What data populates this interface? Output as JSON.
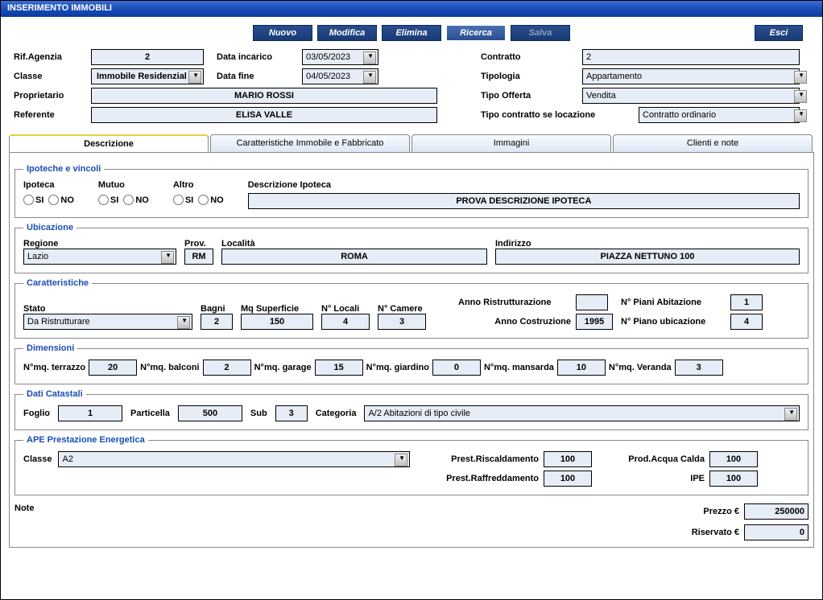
{
  "window": {
    "title": "INSERIMENTO IMMOBILI"
  },
  "toolbar": {
    "nuovo": "Nuovo",
    "modifica": "Modifica",
    "elimina": "Elimina",
    "ricerca": "Ricerca",
    "salva": "Salva",
    "esci": "Esci"
  },
  "header": {
    "rif_agenzia_lbl": "Rif.Agenzia",
    "rif_agenzia": "2",
    "classe_lbl": "Classe",
    "classe": "Immobile Residenzial",
    "proprietario_lbl": "Proprietario",
    "proprietario": "MARIO ROSSI",
    "referente_lbl": "Referente",
    "referente": "ELISA VALLE",
    "data_incarico_lbl": "Data incarico",
    "data_incarico": "03/05/2023",
    "data_fine_lbl": "Data fine",
    "data_fine": "04/05/2023",
    "contratto_lbl": "Contratto",
    "contratto": "2",
    "tipologia_lbl": "Tipologia",
    "tipologia": "Appartamento",
    "tipo_offerta_lbl": "Tipo Offerta",
    "tipo_offerta": "Vendita",
    "tipo_contratto_loc_lbl": "Tipo contratto se locazione",
    "tipo_contratto_loc": "Contratto ordinario"
  },
  "tabs": {
    "descrizione": "Descrizione",
    "caratteristiche": "Caratteristiche Immobile e Fabbricato",
    "immagini": "Immagini",
    "clienti": "Clienti e note"
  },
  "ipoteche": {
    "legend": "Ipoteche e vincoli",
    "ipoteca_lbl": "Ipoteca",
    "mutuo_lbl": "Mutuo",
    "altro_lbl": "Altro",
    "si": "SI",
    "no": "NO",
    "desc_lbl": "Descrizione Ipoteca",
    "desc": "PROVA DESCRIZIONE IPOTECA"
  },
  "ubicazione": {
    "legend": "Ubicazione",
    "regione_lbl": "Regione",
    "regione": "Lazio",
    "prov_lbl": "Prov.",
    "prov": "RM",
    "localita_lbl": "Località",
    "localita": "ROMA",
    "indirizzo_lbl": "Indirizzo",
    "indirizzo": "PIAZZA NETTUNO 100"
  },
  "caratteristiche": {
    "legend": "Caratteristiche",
    "stato_lbl": "Stato",
    "stato": "Da Ristrutturare",
    "bagni_lbl": "Bagni",
    "bagni": "2",
    "mq_lbl": "Mq Superficie",
    "mq": "150",
    "locali_lbl": "N° Locali",
    "locali": "4",
    "camere_lbl": "N° Camere",
    "camere": "3",
    "anno_ristr_lbl": "Anno Ristrutturazione",
    "anno_ristr": "",
    "anno_costr_lbl": "Anno Costruzione",
    "anno_costr": "1995",
    "n_piani_lbl": "N° Piani Abitazione",
    "n_piani": "1",
    "n_piano_ub_lbl": "N° Piano ubicazione",
    "n_piano_ub": "4"
  },
  "dimensioni": {
    "legend": "Dimensioni",
    "terrazzo_lbl": "N°mq. terrazzo",
    "terrazzo": "20",
    "balconi_lbl": "N°mq. balconi",
    "balconi": "2",
    "garage_lbl": "N°mq. garage",
    "garage": "15",
    "giardino_lbl": "N°mq. giardino",
    "giardino": "0",
    "mansarda_lbl": "N°mq. mansarda",
    "mansarda": "10",
    "veranda_lbl": "N°mq. Veranda",
    "veranda": "3"
  },
  "catastali": {
    "legend": "Dati Catastali",
    "foglio_lbl": "Foglio",
    "foglio": "1",
    "particella_lbl": "Particella",
    "particella": "500",
    "sub_lbl": "Sub",
    "sub": "3",
    "categoria_lbl": "Categoria",
    "categoria": "A/2 Abitazioni di tipo civile"
  },
  "ape": {
    "legend": "APE Prestazione Energetica",
    "classe_lbl": "Classe",
    "classe": "A2",
    "risc_lbl": "Prest.Riscaldamento",
    "risc": "100",
    "raffr_lbl": "Prest.Raffreddamento",
    "raffr": "100",
    "acqua_lbl": "Prod.Acqua Calda",
    "acqua": "100",
    "ipe_lbl": "IPE",
    "ipe": "100"
  },
  "footer": {
    "note_lbl": "Note",
    "prezzo_lbl": "Prezzo €",
    "prezzo": "250000",
    "riservato_lbl": "Riservato €",
    "riservato": "0"
  }
}
